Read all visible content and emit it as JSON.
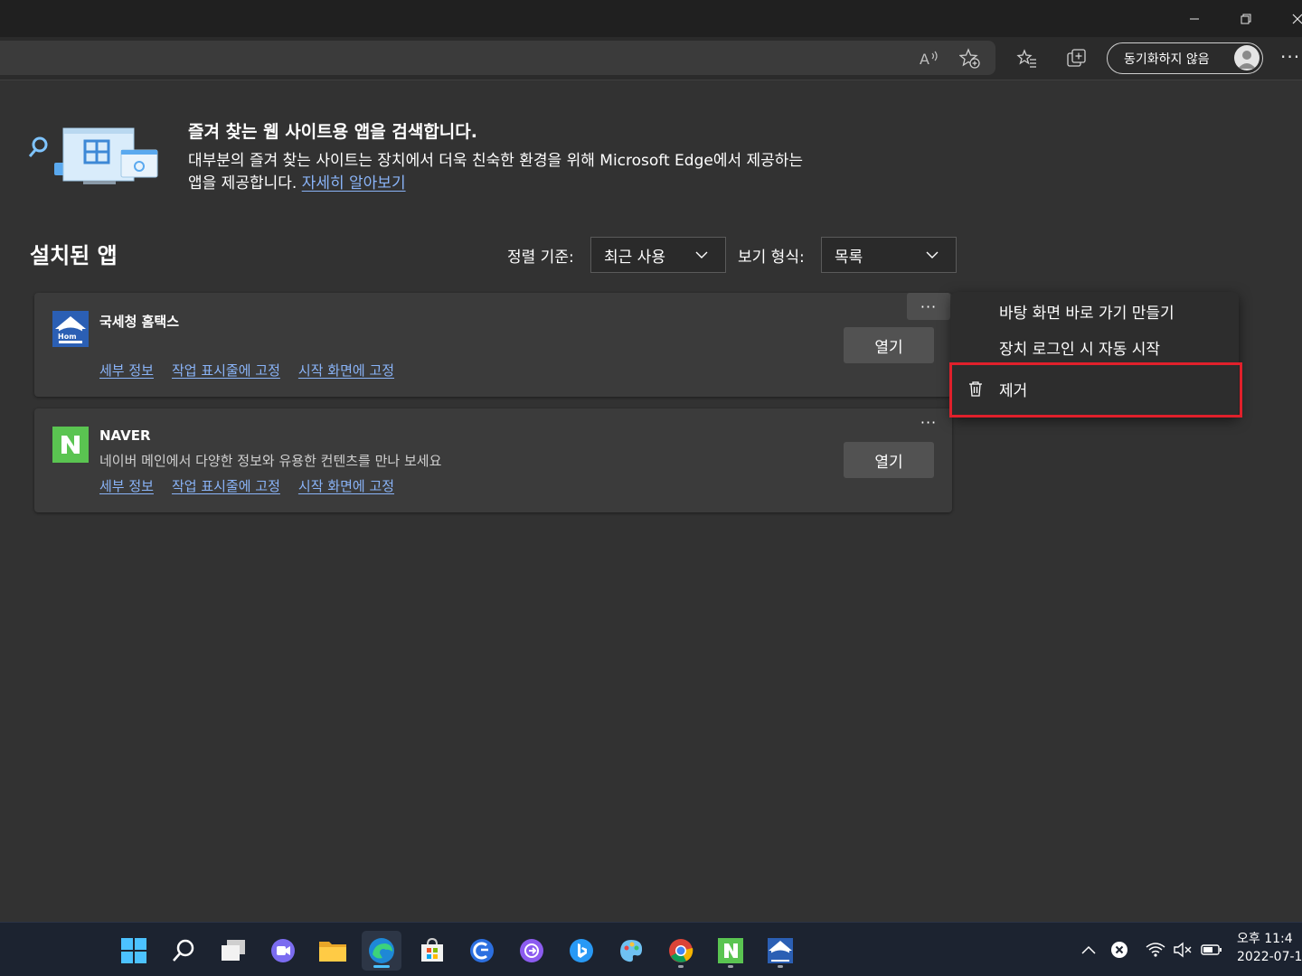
{
  "toolbar": {
    "sync_label": "동기화하지 않음"
  },
  "banner": {
    "title": "즐겨 찾는 웹 사이트용 앱을 검색합니다.",
    "desc_line1": "대부분의 즐겨 찾는 사이트는 장치에서 더욱 친숙한 환경을 위해 Microsoft Edge에서 제공하는",
    "desc_line2": "앱을 제공합니다.",
    "learn_more": "자세히 알아보기"
  },
  "installed": {
    "title": "설치된 앱",
    "sort_label": "정렬 기준:",
    "sort_value": "최근 사용",
    "view_label": "보기 형식:",
    "view_value": "목록"
  },
  "apps": [
    {
      "name": "국세청 홈택스",
      "description": "",
      "link_details": "세부 정보",
      "link_taskbar": "작업 표시줄에 고정",
      "link_start": "시작 화면에 고정",
      "open_label": "열기",
      "more_label": "···"
    },
    {
      "name": "NAVER",
      "description": "네이버 메인에서 다양한 정보와 유용한 컨텐츠를 만나 보세요",
      "link_details": "세부 정보",
      "link_taskbar": "작업 표시줄에 고정",
      "link_start": "시작 화면에 고정",
      "open_label": "열기",
      "more_label": "···"
    }
  ],
  "context_menu": {
    "items": [
      {
        "label": "바탕 화면 바로 가기 만들기",
        "icon": ""
      },
      {
        "label": "장치 로그인 시 자동 시작",
        "icon": ""
      },
      {
        "label": "제거",
        "icon": "trash-icon"
      }
    ]
  },
  "taskbar": {
    "apps": [
      "start-icon",
      "search-icon",
      "task-view-icon",
      "chat-icon",
      "file-explorer-icon",
      "edge-icon",
      "store-icon",
      "app-icon-1",
      "app-icon-2",
      "bing-icon",
      "paint-icon",
      "chrome-icon",
      "naver-icon",
      "hometax-icon"
    ],
    "clock_time": "오후 11:4",
    "clock_date": "2022-07-1"
  },
  "colors": {
    "background": "#323232",
    "card": "#3b3b3b",
    "link": "#8ab4f8",
    "highlight": "#e0202b",
    "naver_green": "#5ac451",
    "hometax_blue": "#2b5fb4"
  }
}
